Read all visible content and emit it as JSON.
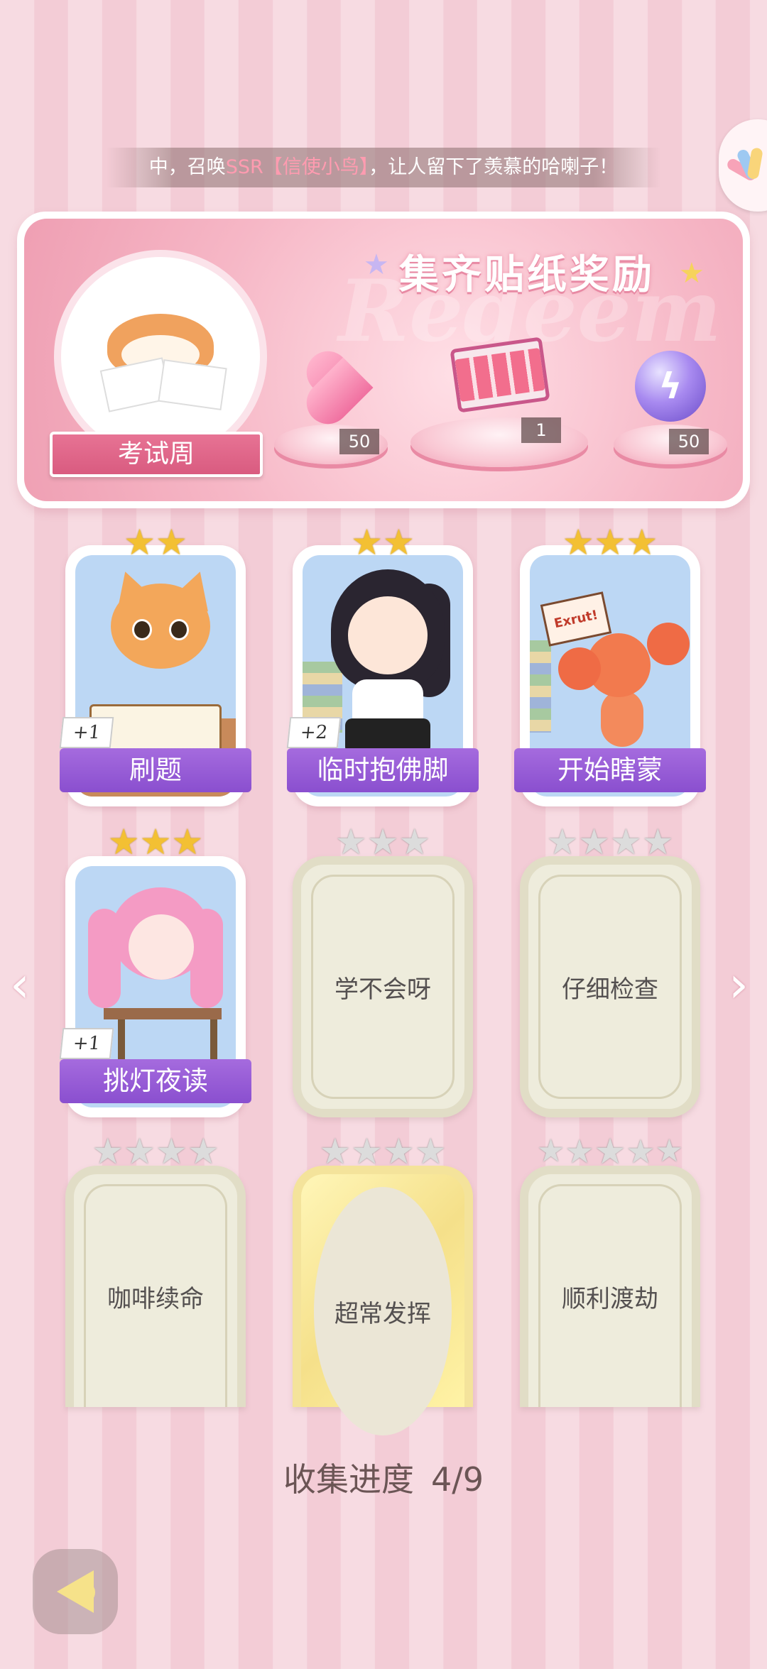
{
  "ticker": {
    "prefix": "中，召唤",
    "highlight": "SSR【信使小鸟】",
    "suffix": "，让人留下了羡慕的哈喇子！"
  },
  "reward": {
    "title": "集齐贴纸奖励",
    "watermark": "Redeem",
    "theme_label": "考试周",
    "items": [
      {
        "icon": "heart-gem-icon",
        "count": "50"
      },
      {
        "icon": "gift-box-icon",
        "count": "1"
      },
      {
        "icon": "lightning-orb-icon",
        "count": "50"
      }
    ]
  },
  "cards": [
    {
      "name": "刷题",
      "stars": 2,
      "star_type": "gold",
      "collected": true,
      "plus": "+1",
      "art": "cat-writing"
    },
    {
      "name": "临时抱佛脚",
      "stars": 2,
      "star_type": "gold",
      "collected": true,
      "plus": "+2",
      "art": "girl-reading"
    },
    {
      "name": "开始瞎蒙",
      "stars": 3,
      "star_type": "gold",
      "collected": true,
      "plus": "",
      "art": "lobster-sign",
      "sign_text": "Exrut!"
    },
    {
      "name": "挑灯夜读",
      "stars": 3,
      "star_type": "gold",
      "collected": true,
      "plus": "+1",
      "art": "pink-girl-desk"
    },
    {
      "name": "学不会呀",
      "stars": 3,
      "star_type": "silver",
      "collected": false
    },
    {
      "name": "仔细检查",
      "stars": 4,
      "star_type": "silver",
      "collected": false
    },
    {
      "name": "咖啡续命",
      "stars": 4,
      "star_type": "silver",
      "collected": false
    },
    {
      "name": "超常发挥",
      "stars": 4,
      "star_type": "silver",
      "collected": false,
      "frame": "gold"
    },
    {
      "name": "顺利渡劫",
      "stars": 5,
      "star_type": "silver",
      "collected": false
    }
  ],
  "progress": {
    "label": "收集进度",
    "value": "4/9"
  },
  "colors": {
    "accent_purple": "#8a4fcf",
    "accent_pink": "#e77394",
    "gold_star": "#f3c033"
  }
}
